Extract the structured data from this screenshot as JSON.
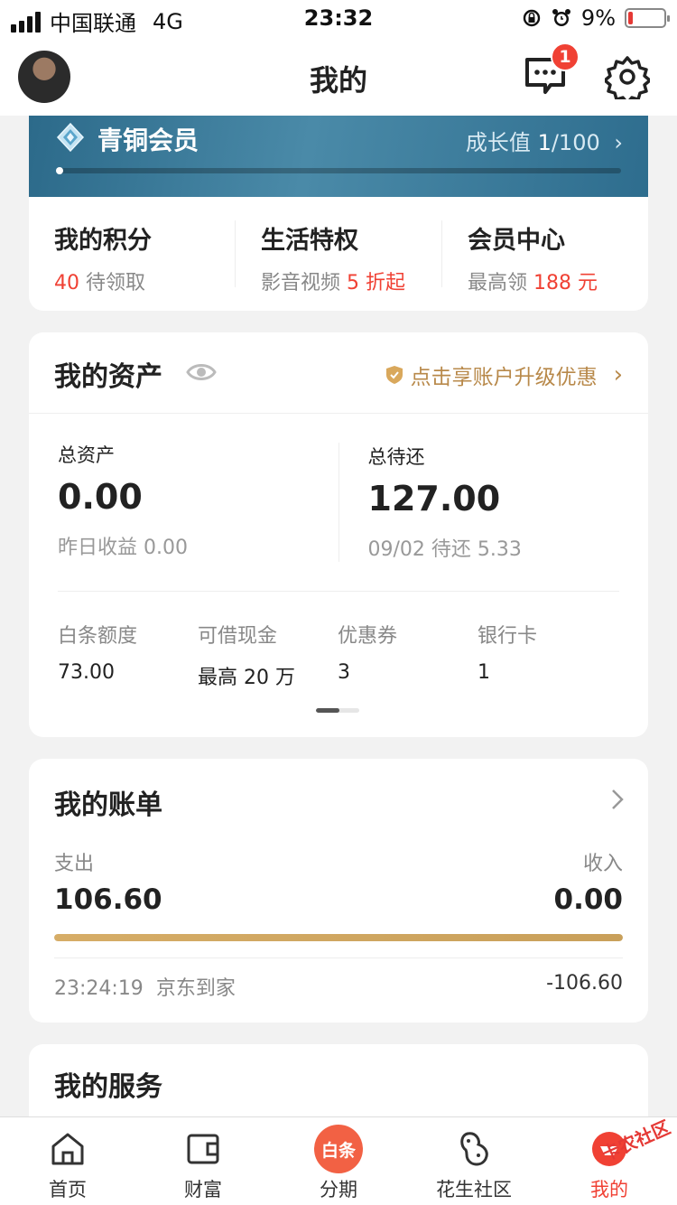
{
  "status_bar": {
    "carrier": "中国联通",
    "network": "4G",
    "time": "23:32",
    "battery": "9%",
    "battery_level": 0.09
  },
  "header": {
    "title": "我的",
    "message_badge": "1"
  },
  "member": {
    "level": "青铜会员",
    "growth_label": "成长值",
    "growth_current": "1",
    "growth_total": "/100",
    "progress": 0.01,
    "perks": [
      {
        "title": "我的积分",
        "highlight": "40",
        "sub": "待领取"
      },
      {
        "title": "生活特权",
        "sub": "影音视频",
        "highlight": "5 折起"
      },
      {
        "title": "会员中心",
        "sub": "最高领",
        "highlight": "188 元"
      }
    ]
  },
  "assets": {
    "title": "我的资产",
    "upgrade_label": "点击享账户升级优惠",
    "total_label": "总资产",
    "total_value": "0.00",
    "yesterday": "昨日收益 0.00",
    "due_label": "总待还",
    "due_value": "127.00",
    "due_sub": "09/02 待还 5.33",
    "grid": [
      {
        "label": "白条额度",
        "value": "73.00"
      },
      {
        "label": "可借现金",
        "value": "最高 20 万"
      },
      {
        "label": "优惠券",
        "value": "3"
      },
      {
        "label": "银行卡",
        "value": "1"
      }
    ]
  },
  "bill": {
    "title": "我的账单",
    "expense_label": "支出",
    "expense_value": "106.60",
    "income_label": "收入",
    "income_value": "0.00",
    "expense_ratio": 1.0,
    "last_time": "23:24:19",
    "last_merchant": "京东到家",
    "last_amount": "-106.60"
  },
  "services": {
    "title": "我的服务"
  },
  "tabs": [
    {
      "label": "首页",
      "icon": "home-icon"
    },
    {
      "label": "财富",
      "icon": "wallet-icon"
    },
    {
      "label": "分期",
      "icon": "baitiao-icon",
      "icon_text": "白条"
    },
    {
      "label": "花生社区",
      "icon": "peanut-icon"
    },
    {
      "label": "我的",
      "icon": "profile-icon",
      "active": true
    }
  ],
  "watermark": "卡农社区",
  "colors": {
    "accent_red": "#f04134",
    "gold": "#b8894a",
    "banner_blue": "#2c6a8a"
  }
}
